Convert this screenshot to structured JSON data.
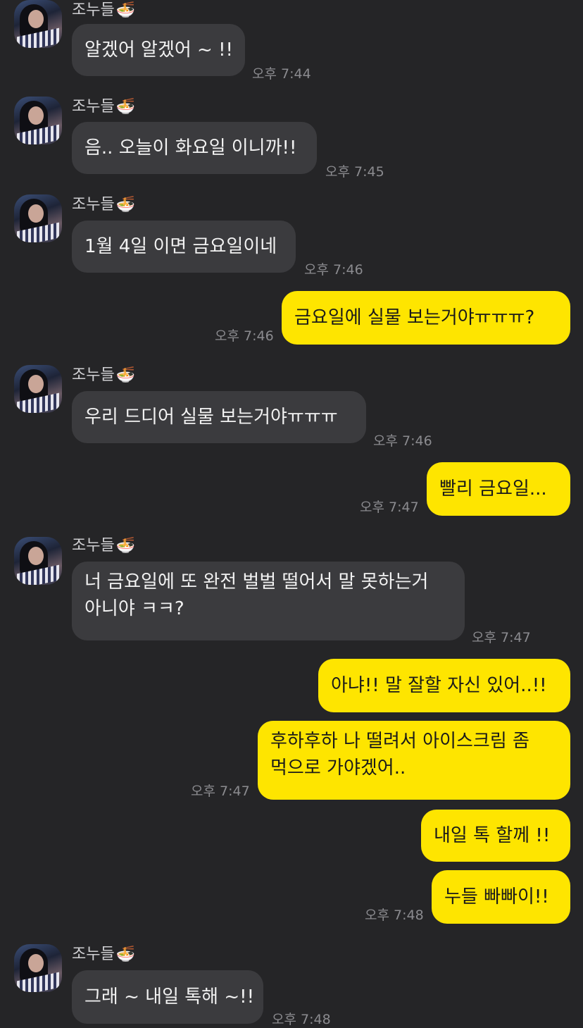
{
  "contact": {
    "name": "조누들",
    "name_icon": "noodle-bowl-icon"
  },
  "colors": {
    "background": "#252527",
    "incoming_bubble": "#3b3b3e",
    "outgoing_bubble": "#fee500",
    "time": "#8b8b8f"
  },
  "messages": [
    {
      "dir": "in",
      "text": "알겠어 알겠어 ~ !!",
      "time": "오후 7:44"
    },
    {
      "dir": "in",
      "text": "음.. 오늘이 화요일 이니까!!",
      "time": "오후 7:45"
    },
    {
      "dir": "in",
      "text": "1월 4일 이면 금요일이네",
      "time": "오후 7:46"
    },
    {
      "dir": "out",
      "text": "금요일에 실물 보는거야ㅠㅠㅠ?",
      "time": "오후 7:46"
    },
    {
      "dir": "in",
      "text": "우리 드디어 실물 보는거야ㅠㅠㅠ",
      "time": "오후 7:46"
    },
    {
      "dir": "out",
      "text": "빨리 금요일...",
      "time": "오후 7:47"
    },
    {
      "dir": "in",
      "line1": "너 금요일에 또 완전 벌벌 떨어서 말 못하는거",
      "line2": "아니야 ㅋㅋ?",
      "time": "오후 7:47"
    },
    {
      "dir": "out",
      "text": "아냐!! 말 잘할 자신 있어..!!"
    },
    {
      "dir": "out",
      "line1": "후하후하 나 떨려서 아이스크림 좀",
      "line2": "먹으로 가야겠어..",
      "time": "오후 7:47"
    },
    {
      "dir": "out",
      "text": "내일 톡 할께 !!"
    },
    {
      "dir": "out",
      "text": "누들 빠빠이!!",
      "time": "오후 7:48"
    },
    {
      "dir": "in",
      "text": "그래 ~ 내일 톡해 ~!!",
      "time": "오후 7:48"
    }
  ]
}
